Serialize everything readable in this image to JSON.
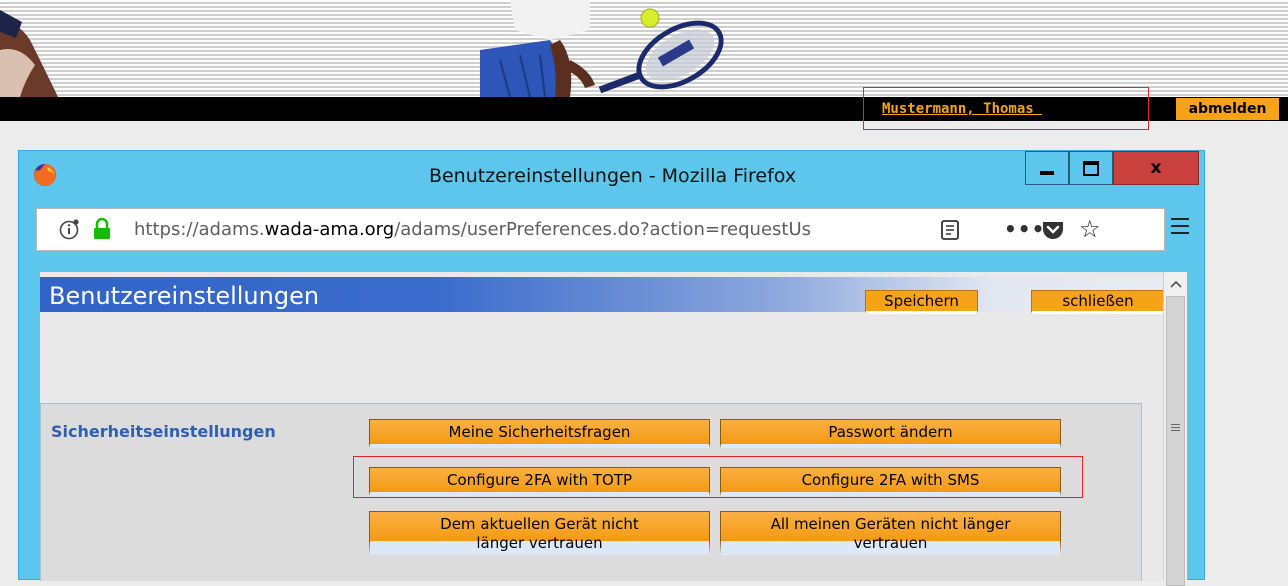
{
  "header": {
    "user_name": "Mustermann, Thomas ",
    "logout_label": "abmelden"
  },
  "browser": {
    "window_title": "Benutzereinstellungen - Mozilla Firefox",
    "close_label": "x",
    "url_prefix": "https://adams.",
    "url_host": "wada-ama.org",
    "url_rest": "/adams/userPreferences.do?action=requestUs",
    "more_label": "•••",
    "star_glyph": "☆"
  },
  "page": {
    "title": "Benutzereinstellungen",
    "save_label": "Speichern",
    "close_label": "schließen",
    "section_label": "Sicherheitseinstellungen",
    "buttons": {
      "security_questions": "Meine Sicherheitsfragen",
      "change_password": "Passwort ändern",
      "configure_totp": "Configure 2FA with TOTP",
      "configure_sms": "Configure 2FA with SMS",
      "untrust_current_line1": "Dem aktuellen Gerät nicht",
      "untrust_current_line2": "länger vertrauen",
      "untrust_all_line1": "All meinen Geräten nicht länger",
      "untrust_all_line2": "vertrauen"
    }
  },
  "colors": {
    "accent_orange": "#f7a31a",
    "header_blue": "#3264c8",
    "firefox_chrome": "#5cc6ec",
    "highlight_red": "#e3242b"
  }
}
